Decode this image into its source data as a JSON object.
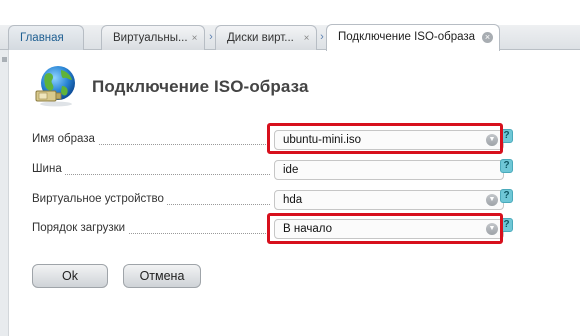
{
  "tabs": [
    {
      "label": "Главная"
    },
    {
      "label": "Виртуальны...",
      "close": "×"
    },
    {
      "label": "Диски вирт...",
      "close": "×"
    },
    {
      "label": "Подключение ISO-образа",
      "close": "×"
    }
  ],
  "breadcrumb_separator": "›",
  "page_title": "Подключение ISO-образа",
  "form": {
    "fields": [
      {
        "label": "Имя образа",
        "value": "ubuntu-mini.iso",
        "type": "select",
        "help": "?"
      },
      {
        "label": "Шина",
        "value": "ide",
        "type": "text",
        "help": "?"
      },
      {
        "label": "Виртуальное устройство",
        "value": "hda",
        "type": "select",
        "help": "?"
      },
      {
        "label": "Порядок загрузки",
        "value": "В начало",
        "type": "select",
        "help": "?"
      }
    ]
  },
  "buttons": {
    "ok": "Ok",
    "cancel": "Отмена"
  },
  "icons": {
    "header": "globe-with-disk-icon",
    "dropdown": "chevron-down-icon",
    "help": "help-icon",
    "tab_close": "close-icon",
    "tab_separator": "chevron-right-icon"
  },
  "colors": {
    "highlight": "#d7101d",
    "help": "#6fc7d6",
    "home_tab_text": "#1f5f92"
  }
}
